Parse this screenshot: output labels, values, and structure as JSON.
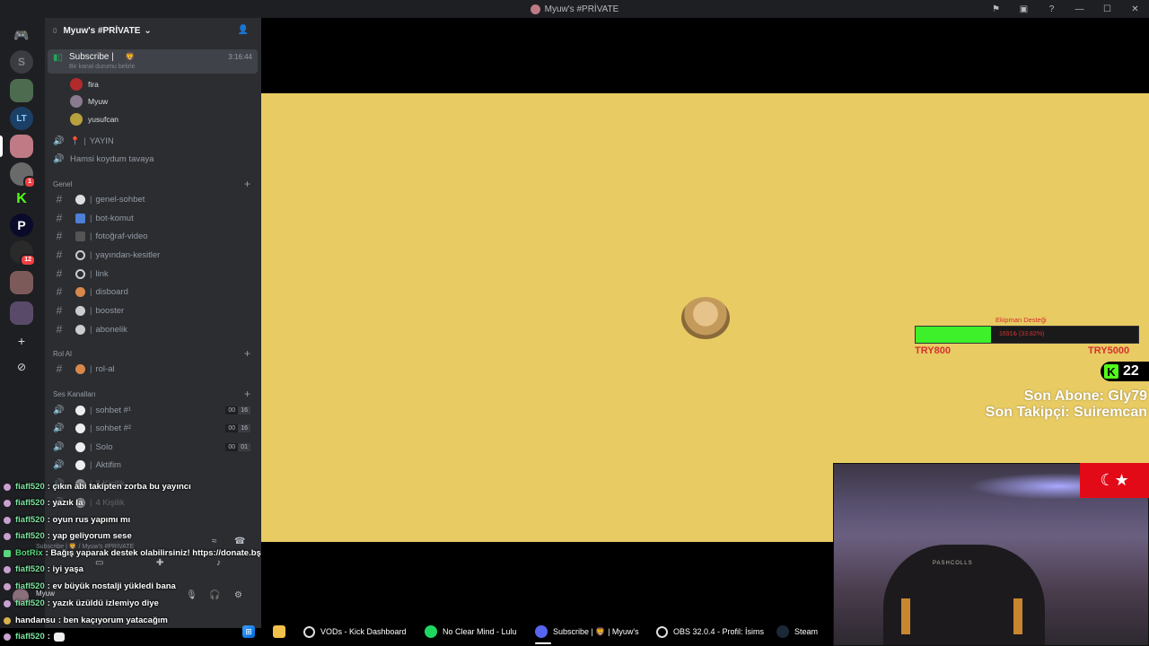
{
  "window": {
    "title": "Myuw's #PRİVATE",
    "buttons": [
      "⚑",
      "▣",
      "?",
      "—",
      "☐",
      "✕"
    ]
  },
  "rail": {
    "badges": [
      "1",
      "12"
    ]
  },
  "server": {
    "boost_count": "0",
    "name": "Myuw's #PRİVATE"
  },
  "voice_active": {
    "name": "Subscribe |",
    "timer": "3:16:44",
    "status": "Bir kanal durumu belirle",
    "users": [
      "fira",
      "Myuw",
      "yusufcan"
    ]
  },
  "top_channels": [
    {
      "icon": "📍",
      "name": "YAYIN"
    },
    {
      "name": "Hamsi koydum tavaya"
    }
  ],
  "categories": {
    "genel": "Genel",
    "rol": "Rol Al",
    "ses": "Ses Kanalları"
  },
  "genel_channels": [
    "genel-sohbet",
    "bot-komut",
    "fotoğraf-video",
    "yayından-kesitler",
    "link",
    "disboard",
    "booster",
    "abonelik"
  ],
  "rol_channels": [
    "rol-al"
  ],
  "voice_channels": [
    {
      "name": "sohbet #¹",
      "c1": "00",
      "c2": "16"
    },
    {
      "name": "sohbet #²",
      "c1": "00",
      "c2": "16"
    },
    {
      "name": "Solo",
      "c1": "00",
      "c2": "01"
    },
    {
      "name": "Aktifim"
    },
    {
      "name": "2 Kişilik"
    },
    {
      "name": "4 Kişilik"
    }
  ],
  "stream": {
    "goal_title": "Ekipman Desteği",
    "goal_text": "1691₺ (33.82%)",
    "goal_progress": 0.338,
    "goal_min": "TRY800",
    "goal_max": "TRY5000",
    "viewer_count": "22",
    "last_sub": "Son Abone: Gly79",
    "last_follow": "Son Takipçi: Suiremcan",
    "chair_brand": "PASHCOLLS"
  },
  "chat": [
    {
      "nick": "fiafl520",
      "msg": ": çıkın abi takipten zorba bu yayıncı"
    },
    {
      "nick": "fiafl520",
      "msg": ": yazık la"
    },
    {
      "nick": "fiafl520",
      "msg": ": oyun rus yapımı mı"
    },
    {
      "nick": "fiafl520",
      "msg": ": yap geliyorum sese"
    },
    {
      "nick": "BotRix",
      "msg": ": Bağış yaparak destek olabilirsiniz! https://donate.bş"
    },
    {
      "nick": "fiafl520",
      "msg": ": iyi yaşa"
    },
    {
      "nick": "fiafl520",
      "msg": ": ev büyük nostalji yükledi bana"
    },
    {
      "nick": "fiafl520",
      "msg": ": yazık üzüldü izlemiyo diye"
    },
    {
      "nick": "handansu",
      "msg": ": ben kaçıyorum yatacağım"
    },
    {
      "nick": "fiafl520",
      "msg": ":"
    }
  ],
  "voice_status": "Subscribe | 🦁 / Myuw's #PRİVATE",
  "userpanel": {
    "name": "Myuw"
  },
  "taskbar": [
    {
      "label": "VODs - Kick Dashboard",
      "icon": "chrome-icon"
    },
    {
      "label": "No Clear Mind - Lulu",
      "icon": "spotify-icon"
    },
    {
      "label": "Subscribe | 🦁 | Myuw's",
      "icon": "discord-icon"
    },
    {
      "label": "OBS 32.0.4 - Profil: İsims",
      "icon": "obs-icon"
    },
    {
      "label": "Steam",
      "icon": "steam-icon"
    }
  ],
  "colors": {
    "accent": "#53fc18",
    "stream_bg": "#e8cb63",
    "goal": "#d63030"
  }
}
